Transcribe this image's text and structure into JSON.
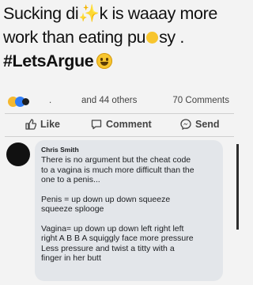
{
  "post": {
    "line1": "Sucking di✨k is waaay more",
    "line2_a": "work than eating pu",
    "line2_b": "sy .",
    "hashtag": "#LetsArgue"
  },
  "reactions": {
    "separator": ".",
    "others_text": "and 44 others",
    "comments_text": "70 Comments"
  },
  "actions": {
    "like_label": "Like",
    "comment_label": "Comment",
    "send_label": "Send"
  },
  "comment": {
    "author": "Chris Smith",
    "p1": [
      "There is no argument but the cheat code",
      "to a vagina is much more difficult than the",
      "one to a penis..."
    ],
    "p2": [
      "Penis = up down up down squeeze",
      "squeeze splooge"
    ],
    "p3": [
      "Vagina= up down up down left right left",
      "right A B B A squiggly face more pressure",
      "Less pressure and twist a titty with a",
      "finger in her butt"
    ]
  }
}
